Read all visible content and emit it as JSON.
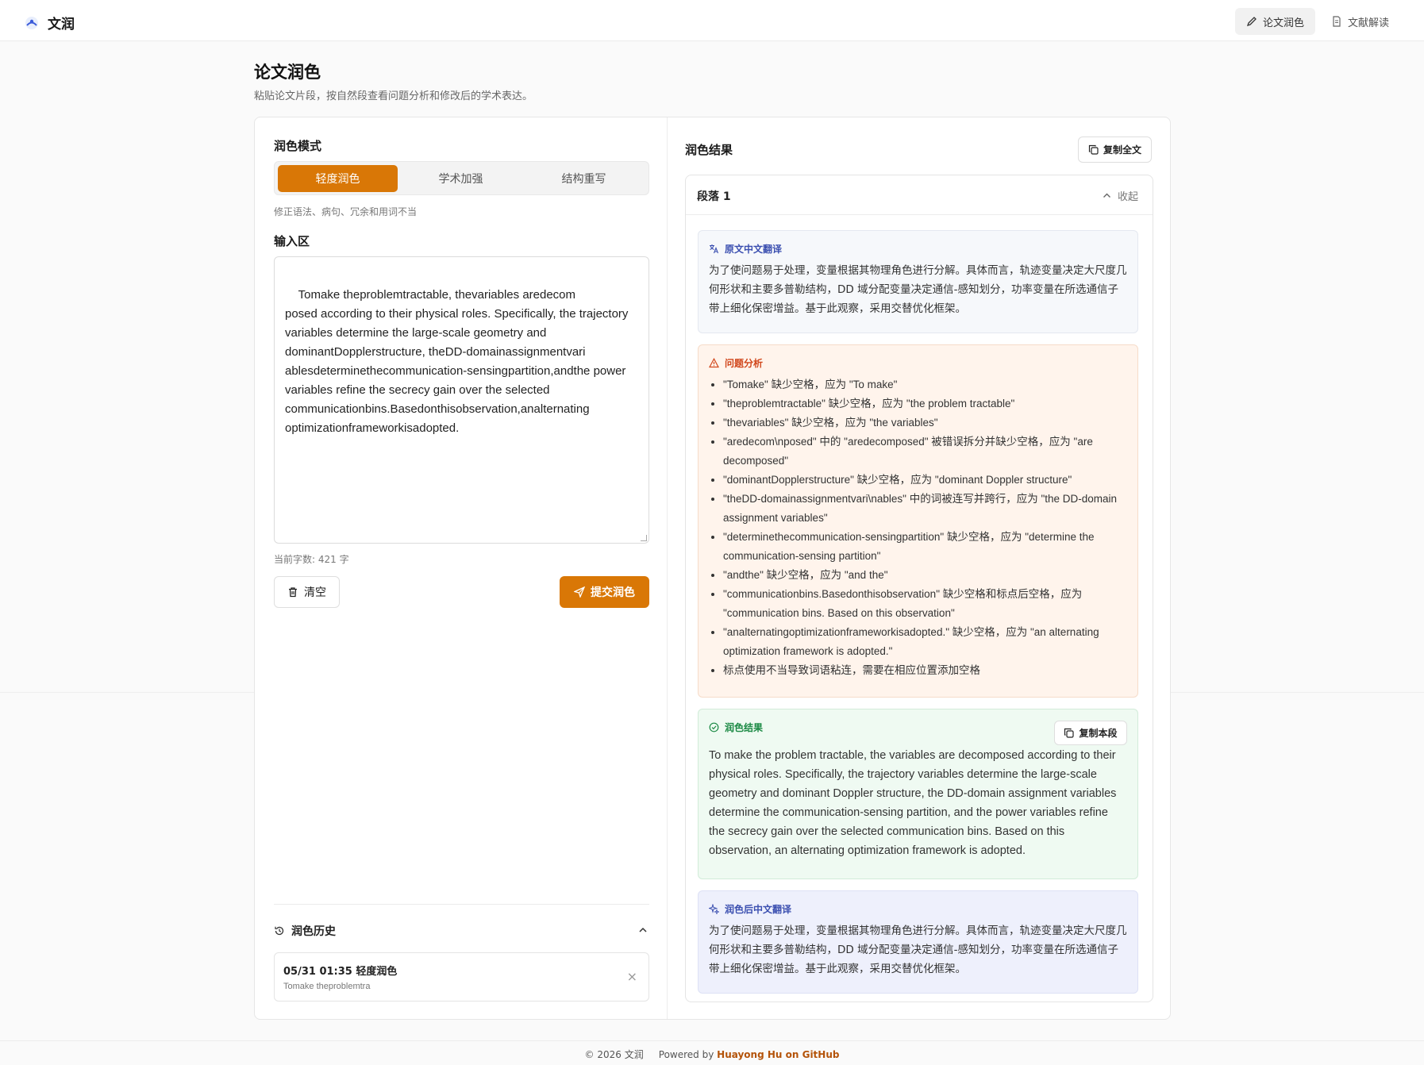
{
  "header": {
    "app_name": "文润",
    "nav": [
      {
        "label": "论文润色",
        "icon": "pencil-icon",
        "active": true
      },
      {
        "label": "文献解读",
        "icon": "document-icon",
        "active": false
      }
    ]
  },
  "page": {
    "title": "论文润色",
    "subtitle": "粘贴论文片段，按自然段查看问题分析和修改后的学术表达。"
  },
  "left": {
    "mode_label": "润色模式",
    "modes": [
      "轻度润色",
      "学术加强",
      "结构重写"
    ],
    "active_mode": 0,
    "mode_hint": "修正语法、病句、冗余和用词不当",
    "input_label": "输入区",
    "input_value": "Tomake theproblemtractable, thevariables aredecom\nposed according to their physical roles. Specifically, the trajectory variables determine the large-scale geometry and dominantDopplerstructure, theDD-domainassignmentvari ablesdeterminethecommunication-sensingpartition,andthe power variables refine the secrecy gain over the selected communicationbins.Basedonthisobservation,analternating optimizationframeworkisadopted.",
    "char_count": "当前字数: 421 字",
    "clear_label": "清空",
    "submit_label": "提交润色",
    "history_label": "润色历史",
    "history_items": [
      {
        "title": "05/31 01:35 轻度润色",
        "preview": "Tomake theproblemtra",
        "close": "×"
      }
    ]
  },
  "right": {
    "title": "润色结果",
    "copy_all_label": "复制全文",
    "paragraph": {
      "title": "段落 1",
      "toggle_label": "收起",
      "translation_title": "原文中文翻译",
      "translation_text": "为了使问题易于处理，变量根据其物理角色进行分解。具体而言，轨迹变量决定大尺度几何形状和主要多普勒结构，DD 域分配变量决定通信-感知划分，功率变量在所选通信子带上细化保密增益。基于此观察，采用交替优化框架。",
      "issues_title": "问题分析",
      "issues": [
        "\"Tomake\" 缺少空格，应为 \"To make\"",
        "\"theproblemtractable\" 缺少空格，应为 \"the problem tractable\"",
        "\"thevariables\" 缺少空格，应为 \"the variables\"",
        "\"aredecom\\nposed\" 中的 \"aredecomposed\" 被错误拆分并缺少空格，应为 \"are decomposed\"",
        "\"dominantDopplerstructure\" 缺少空格，应为 \"dominant Doppler structure\"",
        "\"theDD-domainassignmentvari\\nables\" 中的词被连写并跨行，应为 \"the DD-domain assignment variables\"",
        "\"determinethecommunication-sensingpartition\" 缺少空格，应为 \"determine the communication-sensing partition\"",
        "\"andthe\" 缺少空格，应为 \"and the\"",
        "\"communicationbins.Basedonthisobservation\" 缺少空格和标点后空格，应为 \"communication bins. Based on this observation\"",
        "\"analternatingoptimizationframeworkisadopted.\" 缺少空格，应为 \"an alternating optimization framework is adopted.\"",
        "标点使用不当导致词语粘连，需要在相应位置添加空格"
      ],
      "polished_title": "润色结果",
      "copy_para_label": "复制本段",
      "polished_text": "To make the problem tractable, the variables are decomposed according to their physical roles. Specifically, the trajectory variables determine the large-scale geometry and dominant Doppler structure, the DD-domain assignment variables determine the communication-sensing partition, and the power variables refine the secrecy gain over the selected communication bins. Based on this observation, an alternating optimization framework is adopted.",
      "polished_translation_title": "润色后中文翻译",
      "polished_translation_text": "为了使问题易于处理，变量根据其物理角色进行分解。具体而言，轨迹变量决定大尺度几何形状和主要多普勒结构，DD 域分配变量决定通信-感知划分，功率变量在所选通信子带上细化保密增益。基于此观察，采用交替优化框架。"
    }
  },
  "footer": {
    "copyright": "© 2026 文润",
    "powered_by": "Powered by",
    "link_text": "Huayong Hu on GitHub"
  },
  "colors": {
    "accent": "#d97706",
    "issue_red": "#d1471c",
    "success_green": "#1c8a45",
    "info_blue": "#3b4fb0"
  }
}
